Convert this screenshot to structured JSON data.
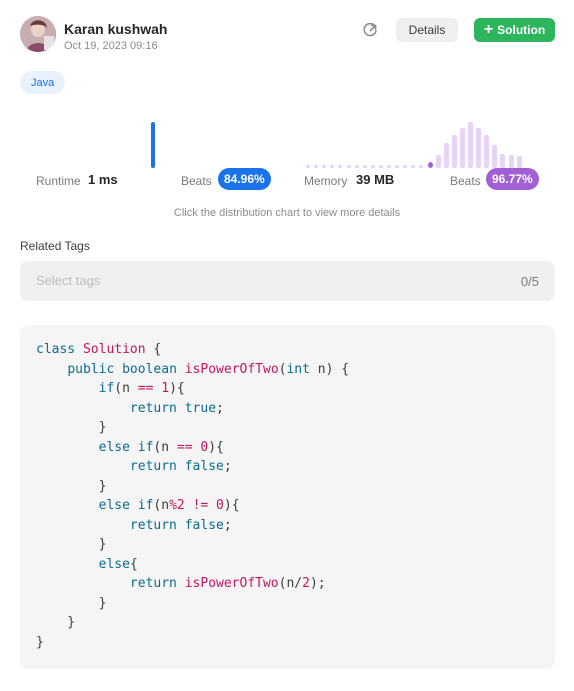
{
  "user": {
    "name": "Karan kushwah",
    "date": "Oct 19, 2023 09:16"
  },
  "header": {
    "details_label": "Details",
    "solution_label": "Solution"
  },
  "language_tag": "Java",
  "runtime": {
    "label": "Runtime",
    "value": "1 ms",
    "beats_label": "Beats",
    "beats_value": "84.96%"
  },
  "memory": {
    "label": "Memory",
    "value": "39 MB",
    "beats_label": "Beats",
    "beats_value": "96.77%"
  },
  "chart_hint": "Click the distribution chart to view more details",
  "related_tags": {
    "label": "Related Tags",
    "placeholder": "Select tags",
    "count": "0/5"
  },
  "colors": {
    "runtime_accent": "#1a73e8",
    "memory_accent": "#a25fd6",
    "memory_bar_light": "#e6d3f5",
    "solution_button": "#2db55d"
  },
  "code_lines": [
    "class Solution {",
    "    public boolean isPowerOfTwo(int n) {",
    "        if(n == 1){",
    "            return true;",
    "        }",
    "        else if(n == 0){",
    "            return false;",
    "        }",
    "        else if(n%2 != 0){",
    "            return false;",
    "        }",
    "        else{",
    "            return isPowerOfTwo(n/2);",
    "        }",
    "    }",
    "}"
  ]
}
